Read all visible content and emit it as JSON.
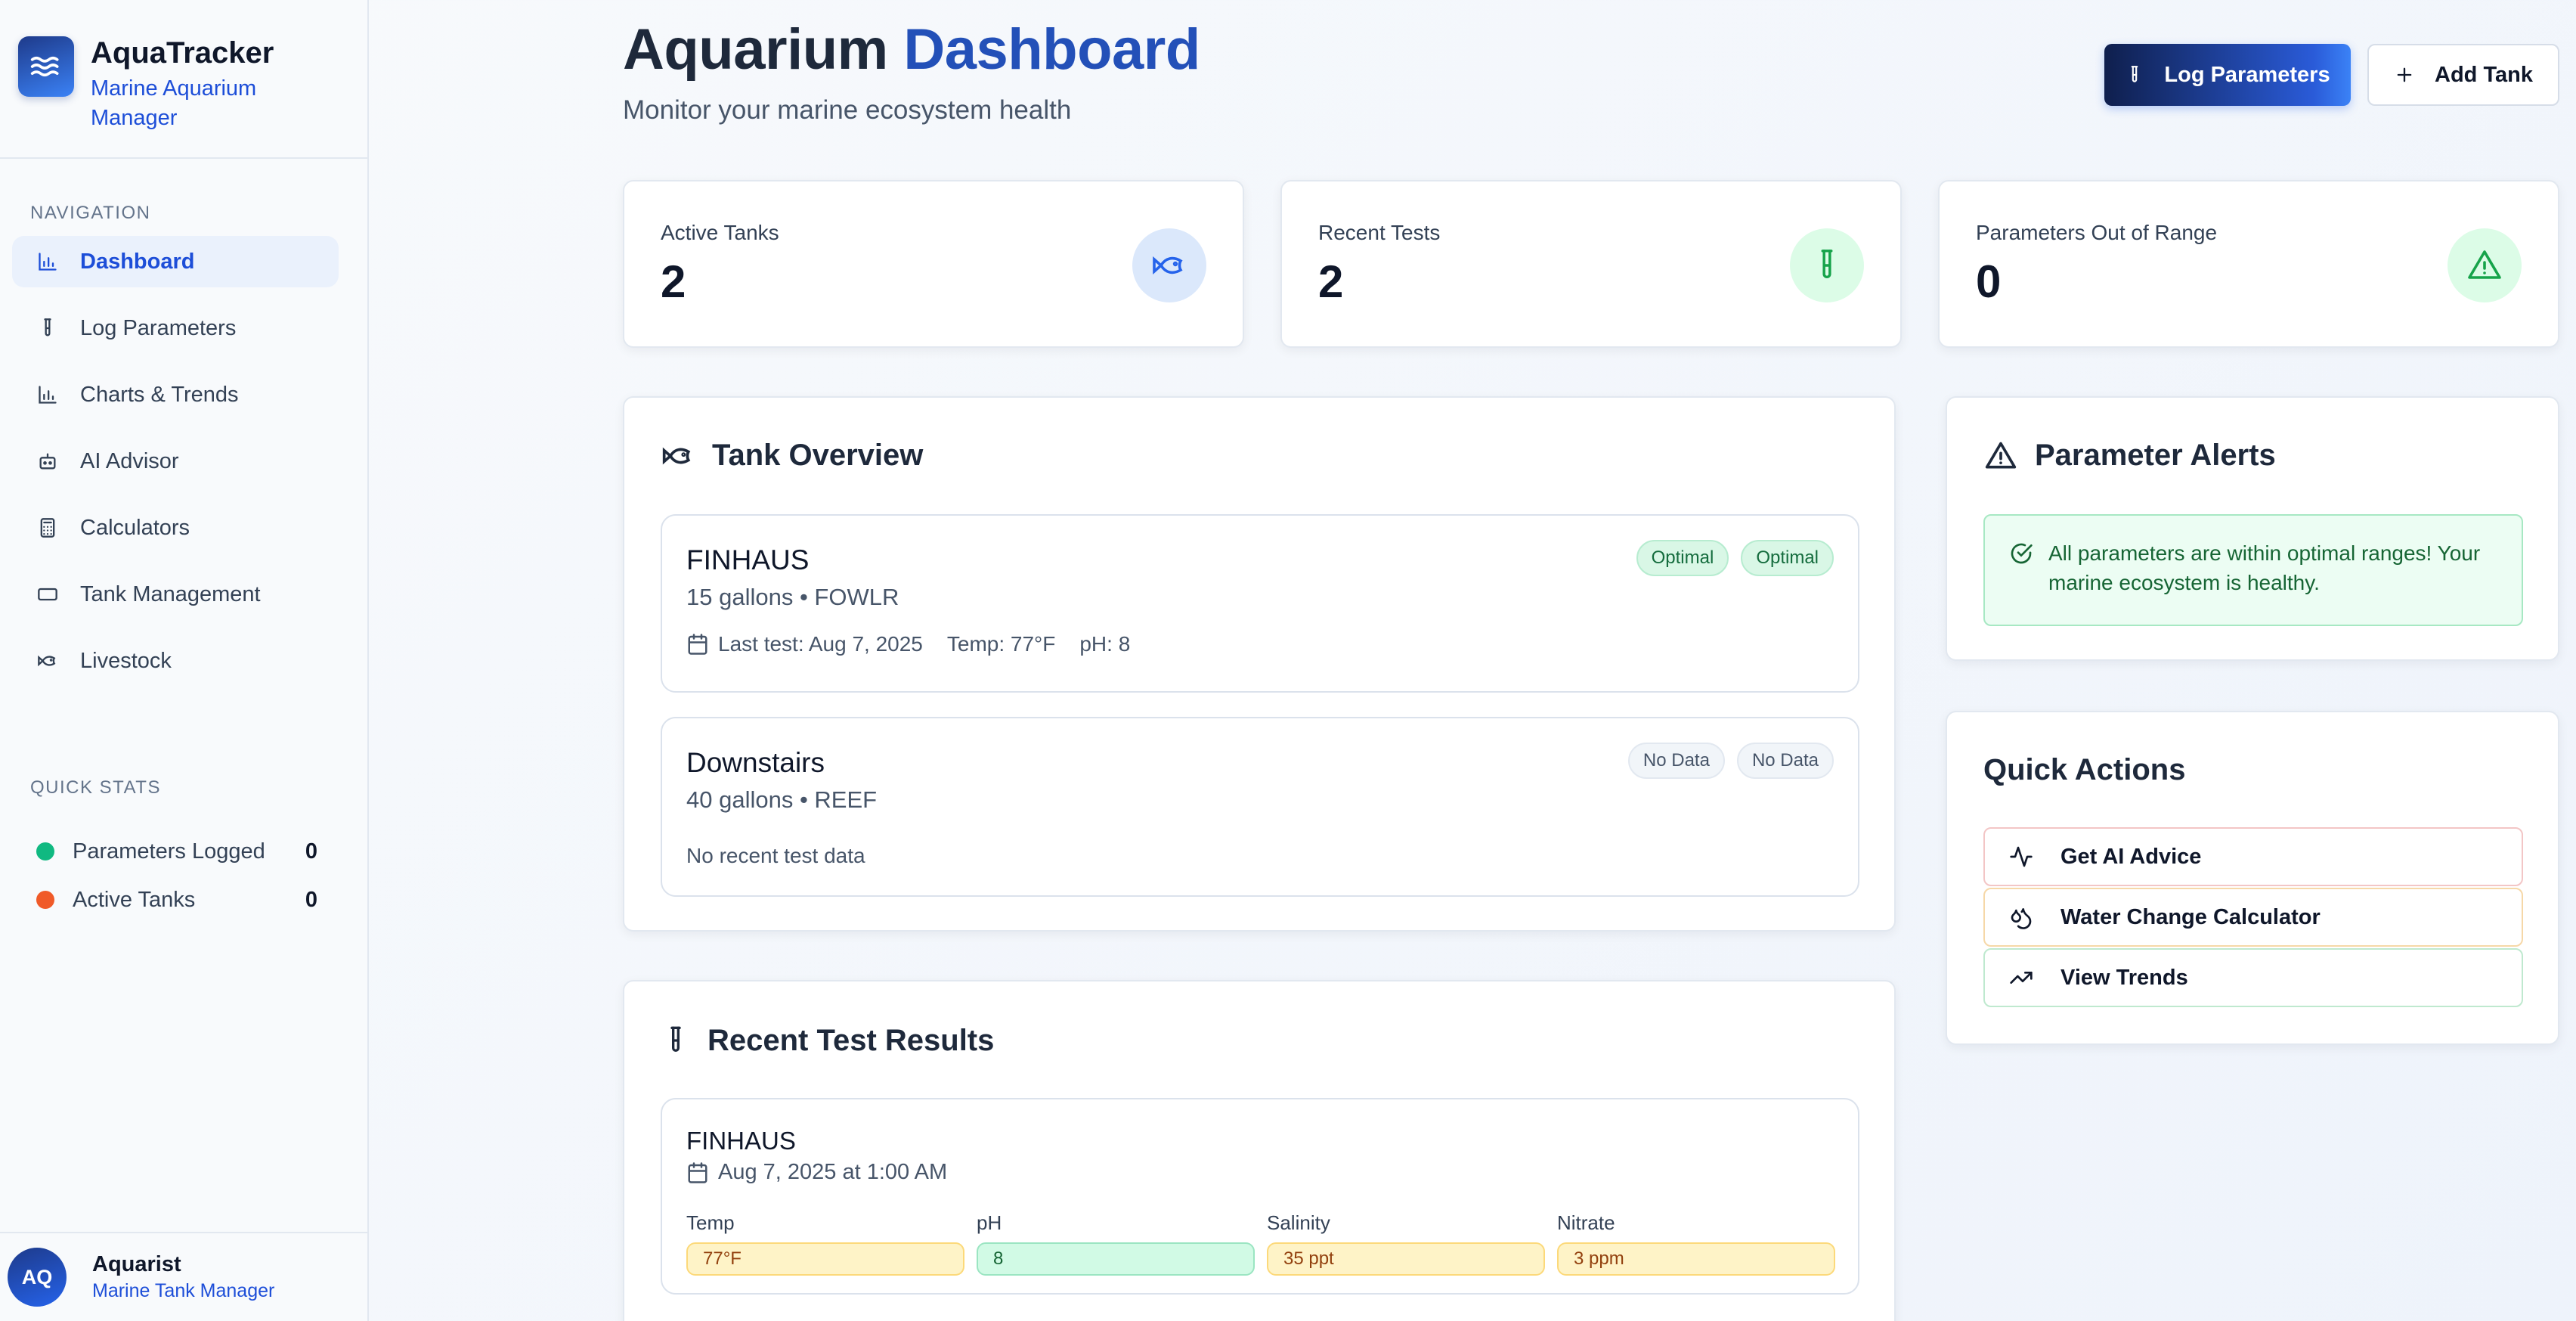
{
  "brand": {
    "title": "AquaTracker",
    "subtitle": "Marine Aquarium Manager"
  },
  "nav": {
    "label": "NAVIGATION",
    "items": [
      {
        "label": "Dashboard",
        "icon": "bar-chart-icon",
        "active": true
      },
      {
        "label": "Log Parameters",
        "icon": "test-tube-icon"
      },
      {
        "label": "Charts & Trends",
        "icon": "bar-chart-icon"
      },
      {
        "label": "AI Advisor",
        "icon": "bot-icon"
      },
      {
        "label": "Calculators",
        "icon": "calculator-icon"
      },
      {
        "label": "Tank Management",
        "icon": "rectangle-icon"
      },
      {
        "label": "Livestock",
        "icon": "fish-icon"
      }
    ]
  },
  "quick_stats": {
    "label": "QUICK STATS",
    "items": [
      {
        "label": "Parameters Logged",
        "value": "0",
        "color": "#10b981"
      },
      {
        "label": "Active Tanks",
        "value": "0",
        "color": "#f05a28"
      }
    ]
  },
  "user": {
    "initials": "AQ",
    "name": "Aquarist",
    "role": "Marine Tank Manager"
  },
  "header": {
    "title_main": "Aquarium",
    "title_accent": "Dashboard",
    "subtitle": "Monitor your marine ecosystem health",
    "log_button": "Log Parameters",
    "add_button": "Add Tank"
  },
  "stats": [
    {
      "label": "Active Tanks",
      "value": "2",
      "icon": "fish-icon"
    },
    {
      "label": "Recent Tests",
      "value": "2",
      "icon": "test-tube-icon"
    },
    {
      "label": "Parameters Out of Range",
      "value": "0",
      "icon": "warning-icon"
    }
  ],
  "tank_overview": {
    "title": "Tank Overview",
    "tanks": [
      {
        "name": "FINHAUS",
        "meta": "15 gallons • FOWLR",
        "last_test": "Last test: Aug 7, 2025",
        "temp": "Temp: 77°F",
        "ph": "pH: 8",
        "badges": [
          "Optimal",
          "Optimal"
        ]
      },
      {
        "name": "Downstairs",
        "meta": "40 gallons • REEF",
        "no_data": "No recent test data",
        "badges": [
          "No Data",
          "No Data"
        ]
      }
    ]
  },
  "alerts": {
    "title": "Parameter Alerts",
    "message": "All parameters are within optimal ranges! Your marine ecosystem is healthy."
  },
  "quick_actions": {
    "title": "Quick Actions",
    "items": [
      {
        "label": "Get AI Advice",
        "icon": "activity-icon",
        "border": "#f3c6c6"
      },
      {
        "label": "Water Change Calculator",
        "icon": "droplets-icon",
        "border": "#f6d8a8"
      },
      {
        "label": "View Trends",
        "icon": "trending-up-icon",
        "border": "#bfe9cf"
      }
    ]
  },
  "recent_results": {
    "title": "Recent Test Results",
    "entries": [
      {
        "tank": "FINHAUS",
        "date": "Aug 7, 2025 at 1:00 AM",
        "params": [
          {
            "label": "Temp",
            "value": "77°F",
            "status": "warn"
          },
          {
            "label": "pH",
            "value": "8",
            "status": "ok"
          },
          {
            "label": "Salinity",
            "value": "35 ppt",
            "status": "warn"
          },
          {
            "label": "Nitrate",
            "value": "3 ppm",
            "status": "warn"
          }
        ]
      }
    ]
  }
}
